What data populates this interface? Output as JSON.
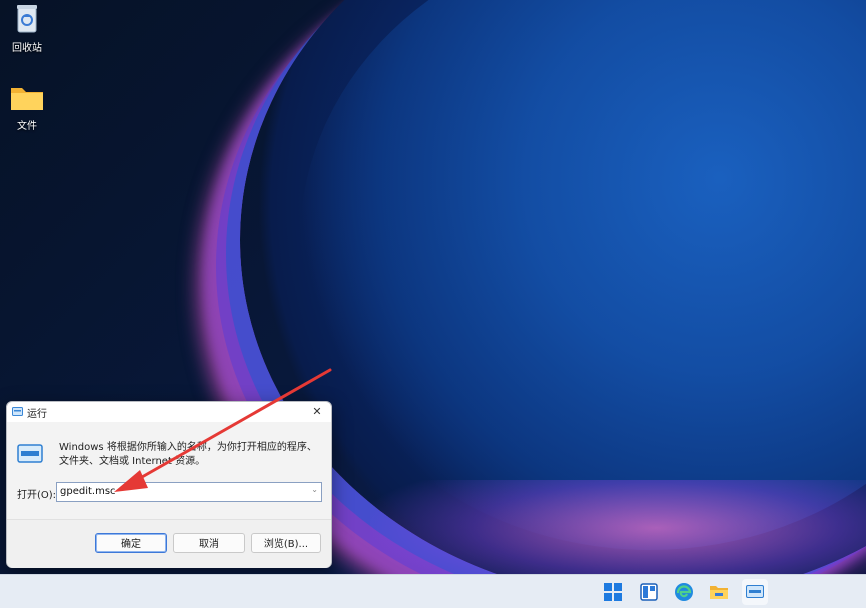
{
  "desktop": {
    "icons": [
      {
        "label": "回收站",
        "icon": "recycle-bin-icon"
      },
      {
        "label": "文件",
        "icon": "folder-icon"
      }
    ]
  },
  "run_dialog": {
    "title": "运行",
    "description": "Windows 将根据你所输入的名称，为你打开相应的程序、文件夹、文档或 Internet 资源。",
    "open_label": "打开(O):",
    "input_value": "gpedit.msc",
    "ok_label": "确定",
    "cancel_label": "取消",
    "browse_label": "浏览(B)...",
    "accent_color": "#3d78d8"
  },
  "annotation": {
    "arrow_color": "#e53935"
  },
  "taskbar": {
    "items": [
      "start-icon",
      "widgets-icon",
      "edge-icon",
      "file-explorer-icon",
      "run-app-icon"
    ]
  }
}
